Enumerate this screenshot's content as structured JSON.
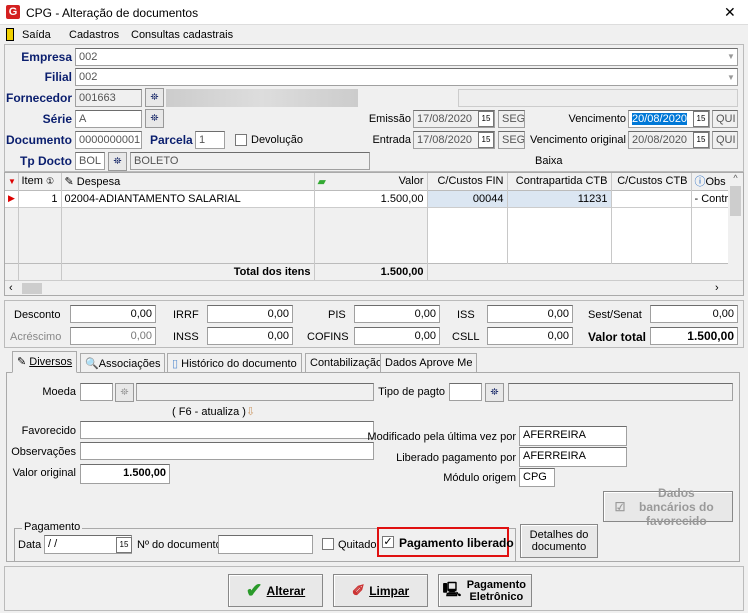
{
  "window": {
    "title": "CPG - Alteração de documentos",
    "close": "✕"
  },
  "menu": [
    "Saída",
    "Cadastros",
    "Consultas cadastrais"
  ],
  "header": {
    "empresa_label": "Empresa",
    "empresa": "002",
    "filial_label": "Filial",
    "filial": "002",
    "fornecedor_label": "Fornecedor",
    "fornecedor": "001663",
    "serie_label": "Série",
    "serie": "A",
    "emissao_label": "Emissão",
    "emissao": "17/08/2020",
    "emissao_dia": "SEG",
    "vencimento_label": "Vencimento",
    "vencimento": "20/08/2020",
    "vencimento_dia": "QUI",
    "documento_label": "Documento",
    "documento": "0000000001",
    "parcela_label": "Parcela",
    "parcela": "1",
    "devolucao_label": "Devolução",
    "devolucao_checked": false,
    "entrada_label": "Entrada",
    "entrada": "17/08/2020",
    "entrada_dia": "SEG",
    "venc_original_label": "Vencimento original",
    "venc_original": "20/08/2020",
    "venc_original_dia": "QUI",
    "tpdocto_label": "Tp Docto",
    "tpdocto": "BOL",
    "tpdocto_desc": "BOLETO",
    "baixa_label": "Baixa"
  },
  "grid": {
    "columns": [
      "Item",
      "Despesa",
      "Valor",
      "C/Custos FIN",
      "Contrapartida CTB",
      "C/Custos CTB",
      "Obs"
    ],
    "rows": [
      {
        "item": "1",
        "despesa": "02004-ADIANTAMENTO SALARIAL",
        "valor": "1.500,00",
        "ccfin": "00044",
        "contrapartida": "11231",
        "ccctb": "",
        "obs": "- Contra"
      }
    ],
    "total_label": "Total dos itens",
    "total": "1.500,00"
  },
  "totals": {
    "desconto_label": "Desconto",
    "desconto": "0,00",
    "irrf_label": "IRRF",
    "irrf": "0,00",
    "pis_label": "PIS",
    "pis": "0,00",
    "iss_label": "ISS",
    "iss": "0,00",
    "sest_label": "Sest/Senat",
    "sest": "0,00",
    "acrescimo_label": "Acréscimo",
    "acrescimo": "0,00",
    "inss_label": "INSS",
    "inss": "0,00",
    "cofins_label": "COFINS",
    "cofins": "0,00",
    "csll_label": "CSLL",
    "csll": "0,00",
    "valor_total_label": "Valor total",
    "valor_total": "1.500,00"
  },
  "tabs": [
    "Diversos",
    "Associações",
    "Histórico do documento",
    "Contabilização",
    "Dados Aprove Me"
  ],
  "diversos": {
    "moeda_label": "Moeda",
    "moeda": "",
    "tipo_pagto_label": "Tipo de pagto",
    "tipo_pagto": "",
    "f6_hint": "( F6 - atualiza )",
    "favorecido_label": "Favorecido",
    "favorecido": "",
    "observacoes_label": "Observações",
    "observacoes": "",
    "valor_original_label": "Valor original",
    "valor_original": "1.500,00",
    "modificado_label": "Modificado pela última vez por",
    "modificado": "AFERREIRA",
    "liberado_label": "Liberado pagamento por",
    "liberado": "AFERREIRA",
    "modulo_label": "Módulo origem",
    "modulo": "CPG",
    "dados_bancarios": "Dados bancários do favorecido",
    "pagamento_group": "Pagamento",
    "data_label": "Data",
    "data": " / /",
    "ndoc_label": "Nº do documento",
    "ndoc": "",
    "quitado_label": "Quitado",
    "quitado_checked": false,
    "pag_liberado_label": "Pagamento liberado",
    "pag_liberado_checked": true,
    "detalhes": "Detalhes do documento"
  },
  "buttons": {
    "alterar": "Alterar",
    "limpar": "Limpar",
    "pagamento_eletronico": "Pagamento Eletrônico"
  },
  "colors": {
    "highlight_border": "#e01010",
    "selection": "#0078d7",
    "label_blue": "#0a1e6e",
    "cell_selected": "#dbe6f2"
  }
}
